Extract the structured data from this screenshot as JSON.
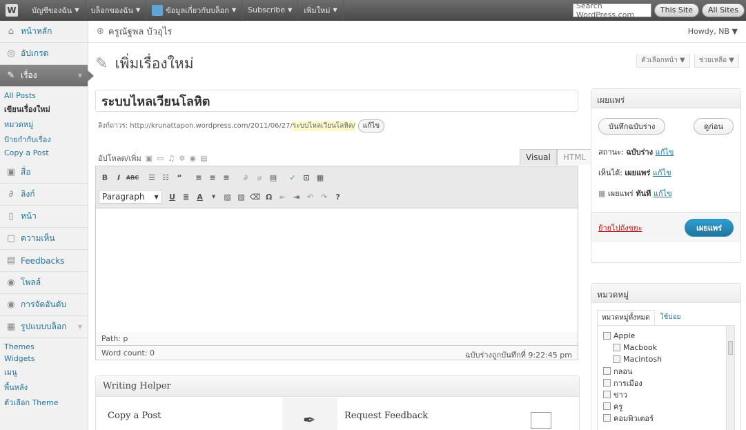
{
  "adminbar": {
    "items": [
      {
        "label": "บัญชีของฉัน"
      },
      {
        "label": "บล็อกของฉัน"
      },
      {
        "label": "ข้อมูลเกี่ยวกับบล็อก"
      },
      {
        "label": "Subscribe"
      },
      {
        "label": "เพิ่มใหม่"
      }
    ],
    "search_placeholder": "Search WordPress.com",
    "this_site": "This Site",
    "all_sites": "All Sites"
  },
  "sidebar": {
    "dashboard": "หน้าหลัก",
    "upgrade": "อัปเกรด",
    "posts": "เรื่อง",
    "posts_sub": [
      "All Posts",
      "เขียนเรื่องใหม่",
      "หมวดหมู่",
      "ป้ายกำกับเรื่อง",
      "Copy a Post"
    ],
    "media": "สื่อ",
    "links": "ลิงก์",
    "pages": "หน้า",
    "comments": "ความเห็น",
    "feedbacks": "Feedbacks",
    "polls": "โพลล์",
    "ratings": "การจัดอันดับ",
    "appearance": "รูปแบบบล็อก",
    "appearance_sub": [
      "Themes",
      "Widgets",
      "เมนู",
      "พื้นหลัง",
      "ตัวเลือก Theme"
    ]
  },
  "top": {
    "site_name": "ครูณัฐพล บัวอุไร",
    "howdy": "Howdy, NB"
  },
  "page": {
    "heading": "เพิ่มเรื่องใหม่",
    "screen_options": "ตัวเลือกหน้า",
    "help": "ช่วยเหลือ"
  },
  "post": {
    "title": "ระบบไหลเวียนโลหิต",
    "permalink_label": "ลิงก์ถาวร:",
    "permalink_base": "http://krunattapon.wordpress.com/2011/06/27/",
    "permalink_slug": "ระบบไหลเวียนโลหิต/",
    "permalink_edit": "แก้ไข"
  },
  "editor": {
    "upload_label": "อัปโหลด/เพิ่ม",
    "tab_visual": "Visual",
    "tab_html": "HTML",
    "format": "Paragraph",
    "path": "Path: p",
    "word_count": "Word count: 0",
    "draft_saved": "ฉบับร่างถูกบันทึกที่ 9:22:45 pm"
  },
  "writing_helper": {
    "title": "Writing Helper",
    "copy_post": "Copy a Post",
    "request_feedback": "Request Feedback"
  },
  "publish": {
    "title": "เผยแพร่",
    "save_draft": "บันทึกฉบับร่าง",
    "preview": "ดูก่อน",
    "status_label": "สถานะ:",
    "status_value": "ฉบับร่าง",
    "visibility_label": "เห็นได้:",
    "visibility_value": "เผยแพร่",
    "schedule_label": "เผยแพร่",
    "schedule_value": "ทันที",
    "edit": "แก้ไข",
    "trash": "ย้ายไปถังขยะ",
    "publish_btn": "เผยแพร่"
  },
  "categories": {
    "title": "หมวดหมู่",
    "tab_all": "หมวดหมู่ทั้งหมด",
    "tab_popular": "ใช้บ่อย",
    "items": [
      {
        "label": "Apple",
        "child": false
      },
      {
        "label": "Macbook",
        "child": true
      },
      {
        "label": "Macintosh",
        "child": true
      },
      {
        "label": "กลอน",
        "child": false
      },
      {
        "label": "การเมือง",
        "child": false
      },
      {
        "label": "ข่าว",
        "child": false
      },
      {
        "label": "ครู",
        "child": false
      },
      {
        "label": "คอมพิวเตอร์",
        "child": false
      }
    ]
  }
}
